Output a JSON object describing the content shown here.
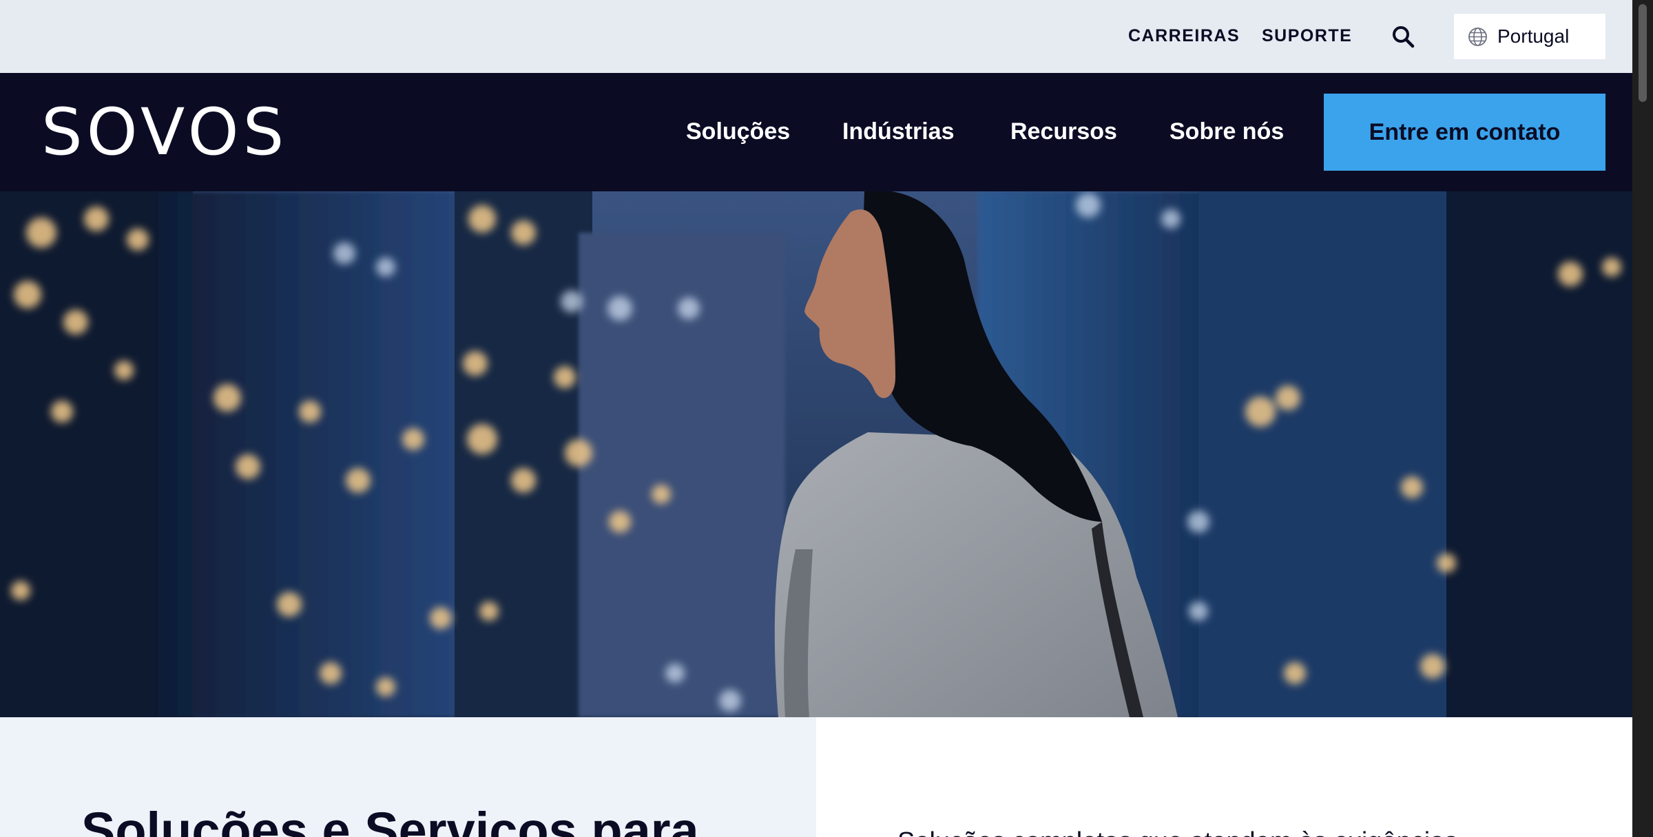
{
  "utility_bar": {
    "careers_label": "CARREIRAS",
    "support_label": "SUPORTE",
    "search_icon": "search-icon",
    "language": {
      "icon": "globe-icon",
      "label": "Portugal"
    }
  },
  "nav": {
    "logo": "SOVOS",
    "items": [
      {
        "label": "Soluções"
      },
      {
        "label": "Indústrias"
      },
      {
        "label": "Recursos"
      },
      {
        "label": "Sobre nós"
      }
    ],
    "cta_label": "Entre em contato"
  },
  "hero": {
    "image": "woman-in-city-at-night"
  },
  "intro": {
    "heading": "Soluções e Serviços para",
    "text": "Soluções completas que atendem às exigências"
  },
  "colors": {
    "navy": "#0b0c24",
    "accent": "#3aa3ec",
    "utility_bg": "#e6eaf1",
    "section_bg": "#eef2f9"
  }
}
